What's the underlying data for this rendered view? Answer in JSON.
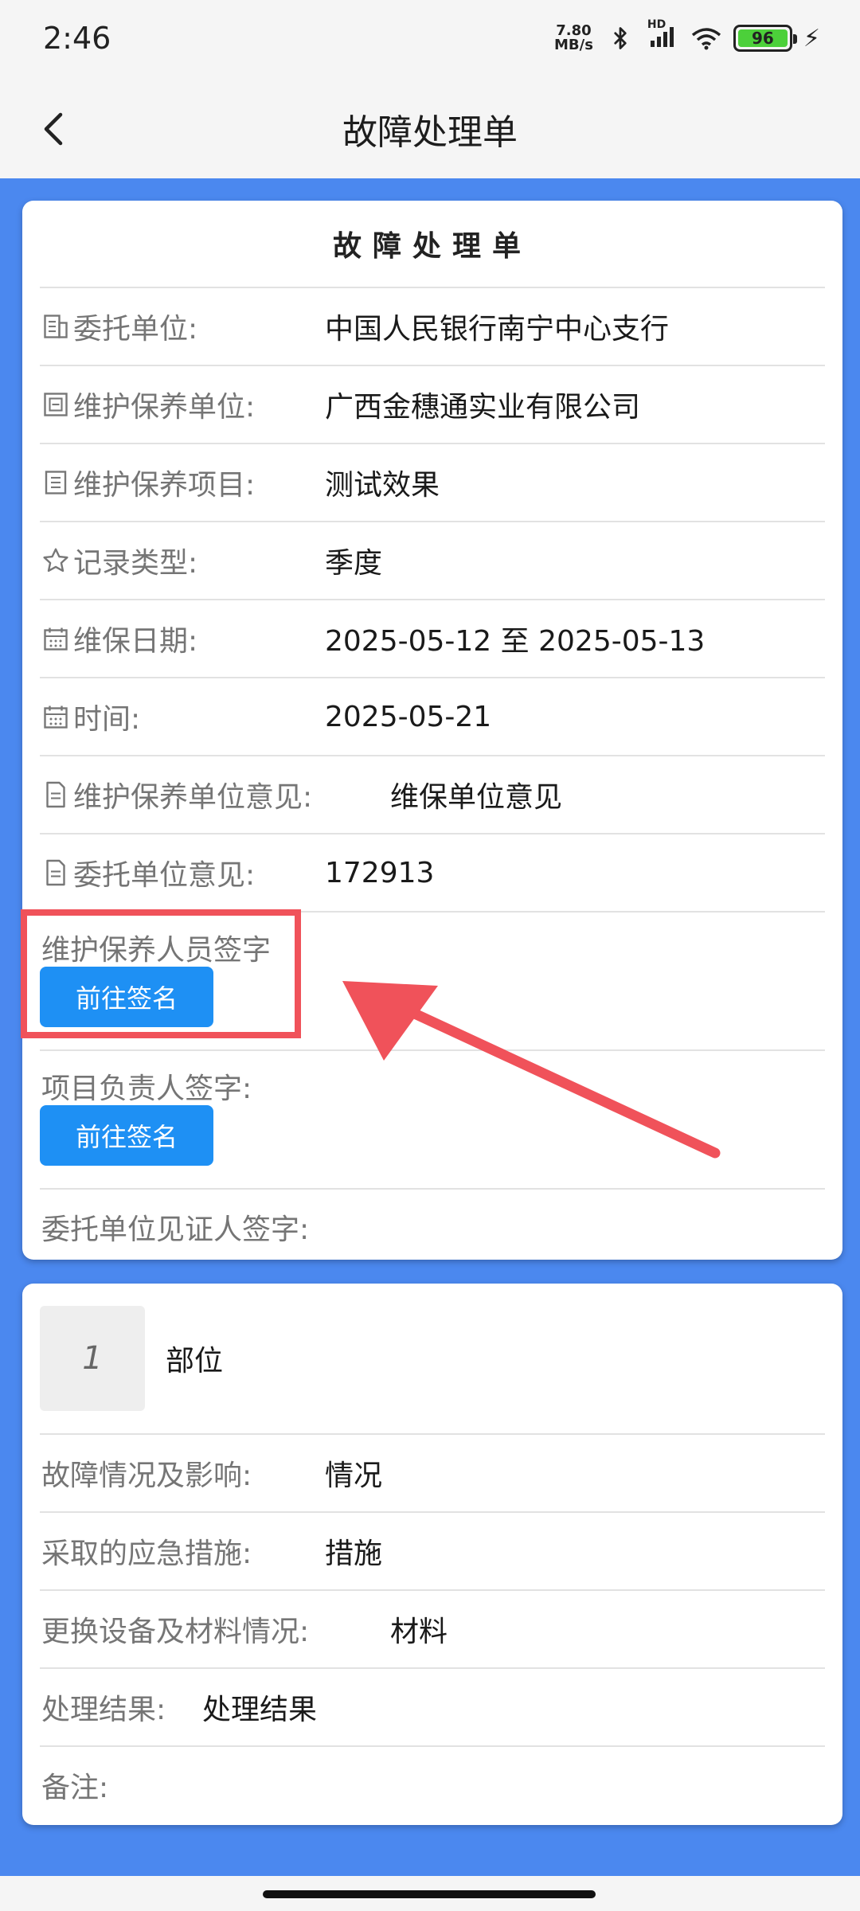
{
  "status_bar": {
    "time": "2:46",
    "net_speed_value": "7.80",
    "net_speed_unit": "MB/s",
    "signal_label": "HD",
    "battery": "96"
  },
  "nav": {
    "title": "故障处理单"
  },
  "form": {
    "title": "故障处理单",
    "rows": [
      {
        "label": "委托单位:",
        "value": "中国人民银行南宁中心支行",
        "icon": "building-icon"
      },
      {
        "label": "维护保养单位:",
        "value": "广西金穗通实业有限公司",
        "icon": "org-icon"
      },
      {
        "label": "维护保养项目:",
        "value": "测试效果",
        "icon": "list-icon"
      },
      {
        "label": "记录类型:",
        "value": "季度",
        "icon": "star-icon"
      },
      {
        "label": "维保日期:",
        "value": "2025-05-12 至 2025-05-13",
        "icon": "calendar-icon"
      },
      {
        "label": "时间:",
        "value": "2025-05-21",
        "icon": "calendar-icon"
      },
      {
        "label": "维护保养单位意见:",
        "value": "维保单位意见",
        "icon": "document-icon"
      },
      {
        "label": "委托单位意见:",
        "value": "172913",
        "icon": "document-icon"
      }
    ],
    "signatures": [
      {
        "label": "维护保养人员签字",
        "button": "前往签名"
      },
      {
        "label": "项目负责人签字:",
        "button": "前往签名"
      },
      {
        "label": "委托单位见证人签字:"
      }
    ]
  },
  "part": {
    "number": "1",
    "name": "部位",
    "rows": [
      {
        "label": "故障情况及影响:",
        "value": "情况"
      },
      {
        "label": "采取的应急措施:",
        "value": "措施"
      },
      {
        "label": "更换设备及材料情况:",
        "value": "材料"
      },
      {
        "label": "处理结果:",
        "value": "处理结果"
      },
      {
        "label": "备注:",
        "value": ""
      }
    ]
  },
  "colors": {
    "background": "#4b88ef",
    "button": "#1e90f4",
    "annotation": "#f0525a"
  }
}
